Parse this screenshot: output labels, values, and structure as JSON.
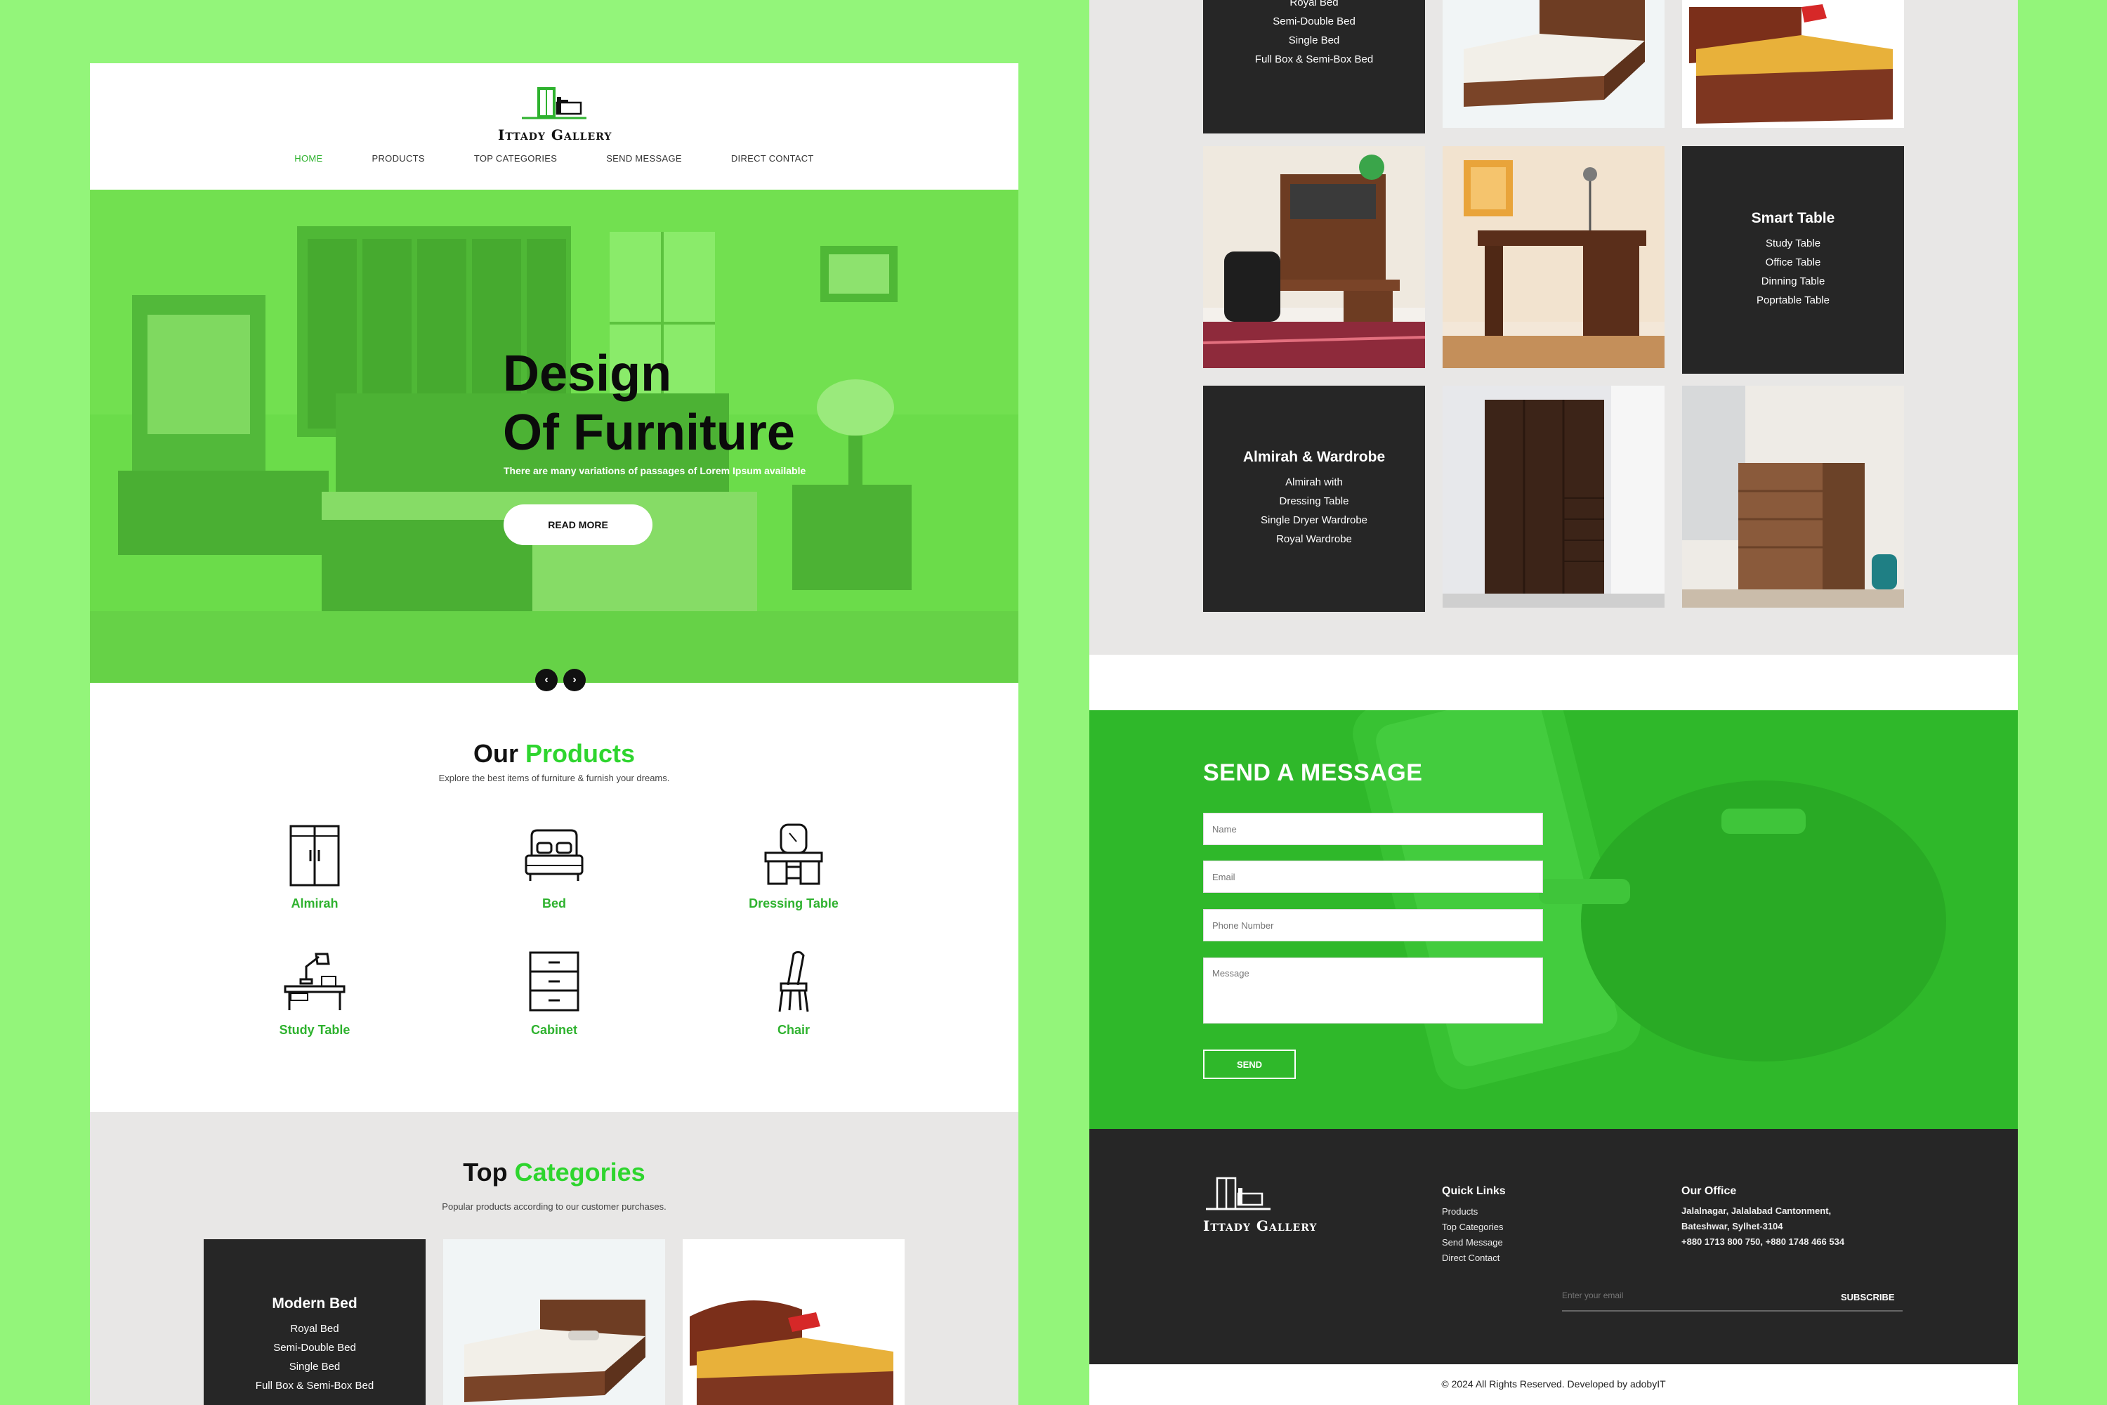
{
  "brand": {
    "name": "Ittady Gallery",
    "accent": "#2ed52e",
    "dark": "#262626"
  },
  "nav": {
    "items": [
      "HOME",
      "PRODUCTS",
      "TOP CATEGORIES",
      "SEND MESSAGE",
      "DIRECT CONTACT"
    ],
    "active": "HOME"
  },
  "hero": {
    "title_line1": "Design",
    "title_line2": "Of Furniture",
    "subtitle": "There are many variations of passages of Lorem Ipsum available",
    "button": "READ MORE",
    "prev_icon": "chevron-left-icon",
    "next_icon": "chevron-right-icon"
  },
  "products": {
    "title_plain": "Our",
    "title_highlight": "Products",
    "subtitle": "Explore the best items of furniture & furnish your dreams.",
    "items": [
      {
        "label": "Almirah",
        "icon": "almirah-icon"
      },
      {
        "label": "Bed",
        "icon": "bed-icon"
      },
      {
        "label": "Dressing Table",
        "icon": "dressing-table-icon"
      },
      {
        "label": "Study Table",
        "icon": "study-table-icon"
      },
      {
        "label": "Cabinet",
        "icon": "cabinet-icon"
      },
      {
        "label": "Chair",
        "icon": "chair-icon"
      }
    ]
  },
  "categories": {
    "title_plain": "Top",
    "title_highlight": "Categories",
    "subtitle": "Popular products according to our customer purchases.",
    "modern_bed": {
      "title": "Modern Bed",
      "items": [
        "Royal Bed",
        "Semi-Double Bed",
        "Single Bed",
        "Full Box & Semi-Box Bed"
      ]
    },
    "smart_table": {
      "title": "Smart Table",
      "items": [
        "Study Table",
        "Office Table",
        "Dinning Table",
        "Poprtable Table"
      ]
    },
    "almirah": {
      "title": "Almirah & Wardrobe",
      "items": [
        "Almirah with",
        "Dressing Table",
        "Single Dryer Wardrobe",
        "Royal Wardrobe"
      ]
    }
  },
  "message": {
    "title": "SEND A MESSAGE",
    "name_placeholder": "Name",
    "email_placeholder": "Email",
    "phone_placeholder": "Phone Number",
    "message_placeholder": "Message",
    "send": "SEND"
  },
  "footer": {
    "quick_links_title": "Quick Links",
    "links": [
      "Products",
      "Top Categories",
      "Send Message",
      "Direct Contact"
    ],
    "office_title": "Our Office",
    "address1": "Jalalnagar, Jalalabad Cantonment,",
    "address2": "Bateshwar, Sylhet-3104",
    "phones": "+880 1713 800 750, +880 1748 466 534",
    "subscribe_placeholder": "Enter your email",
    "subscribe": "SUBSCRIBE",
    "copyright": "© 2024 All Rights Reserved. Developed by adobyIT"
  }
}
